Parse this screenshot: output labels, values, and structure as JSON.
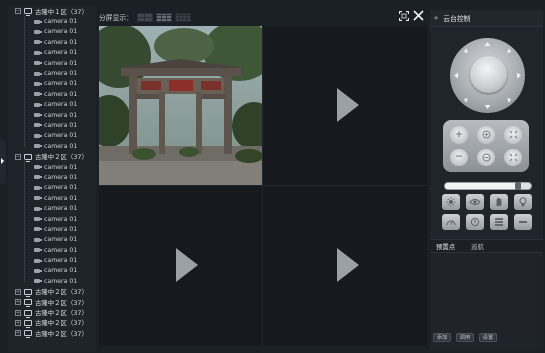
{
  "toolbar": {
    "split_label": "分屏显示：",
    "layouts": [
      "2x2",
      "3x3",
      "4x4"
    ]
  },
  "tree": {
    "groups": [
      {
        "label": "古隆中１区（37）",
        "expanded": true,
        "children": [
          "camera 01",
          "camera 01",
          "camera 01",
          "camera 01",
          "camera 01",
          "camera 01",
          "camera 01",
          "camera 01",
          "camera 01",
          "camera 01",
          "camera 01",
          "camera 01",
          "camera 01"
        ]
      },
      {
        "label": "古隆中２区（37）",
        "expanded": true,
        "children": [
          "camera 01",
          "camera 01",
          "camera 01",
          "camera 01",
          "camera 01",
          "camera 01",
          "camera 01",
          "camera 01",
          "camera 01",
          "camera 01",
          "camera 01",
          "camera 01"
        ]
      },
      {
        "label": "古隆中２区（37）",
        "expanded": false,
        "children": []
      },
      {
        "label": "古隆中２区（37）",
        "expanded": false,
        "children": []
      },
      {
        "label": "古隆中２区（37）",
        "expanded": false,
        "children": []
      },
      {
        "label": "古隆中２区（37）",
        "expanded": false,
        "children": []
      },
      {
        "label": "古隆中２区（37）",
        "expanded": false,
        "children": []
      }
    ]
  },
  "video": {
    "panes": [
      {
        "state": "live"
      },
      {
        "state": "empty"
      },
      {
        "state": "empty"
      },
      {
        "state": "empty"
      }
    ]
  },
  "ptz": {
    "collapse_glyph": "»",
    "title": "云台控制",
    "slider_value": 0.85,
    "tabs": [
      "预置点",
      "巡航"
    ],
    "footer_buttons": [
      "添加",
      "调用",
      "设置"
    ]
  },
  "colors": {
    "background": "#1b1f26",
    "panel": "#1f242b",
    "accent_silver": "#c9cdd2"
  }
}
